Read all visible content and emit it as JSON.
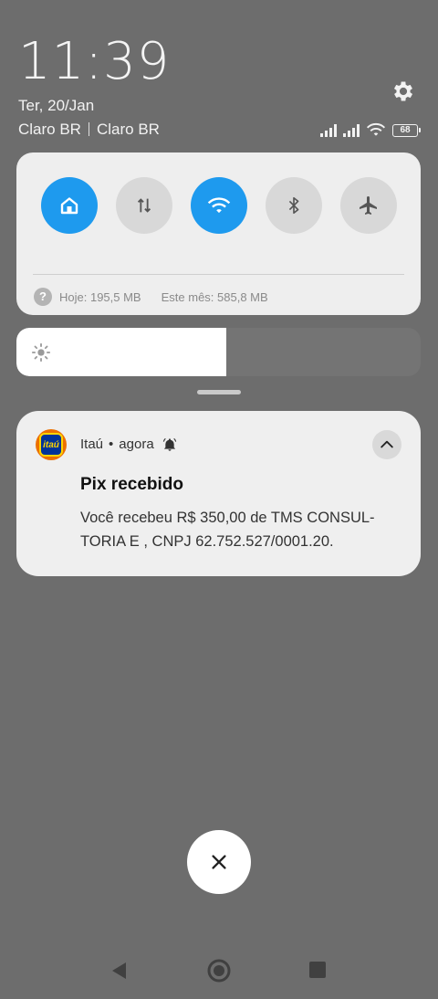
{
  "status_bar": {
    "time": "11:39",
    "date": "Ter, 20/Jan",
    "carrier_1": "Claro BR",
    "carrier_2": "Claro BR",
    "battery": "68"
  },
  "quick_settings": {
    "tiles": [
      {
        "name": "home",
        "icon": "home-icon",
        "active": true
      },
      {
        "name": "mobile-data",
        "icon": "data-arrows-icon",
        "active": false
      },
      {
        "name": "wifi",
        "icon": "wifi-icon",
        "active": true
      },
      {
        "name": "bluetooth",
        "icon": "bluetooth-icon",
        "active": false
      },
      {
        "name": "airplane",
        "icon": "airplane-icon",
        "active": false
      }
    ],
    "data_today": "Hoje: 195,5 MB",
    "data_month": "Este mês: 585,8 MB",
    "brightness_level": 0.52
  },
  "notification": {
    "app_name": "Itaú",
    "app_logo_text": "itaú",
    "separator": "•",
    "time": "agora",
    "title": "Pix recebido",
    "body_line_1": "Você recebeu R$ 350,00 de TMS CONSUL-",
    "body_line_2": "TORIA E , CNPJ 62.752.527/0001.20."
  },
  "colors": {
    "background": "#6d6d6d",
    "panel": "#eeeeee",
    "accent": "#1e9aee",
    "itau_orange": "#ec7000",
    "itau_blue": "#003399"
  }
}
